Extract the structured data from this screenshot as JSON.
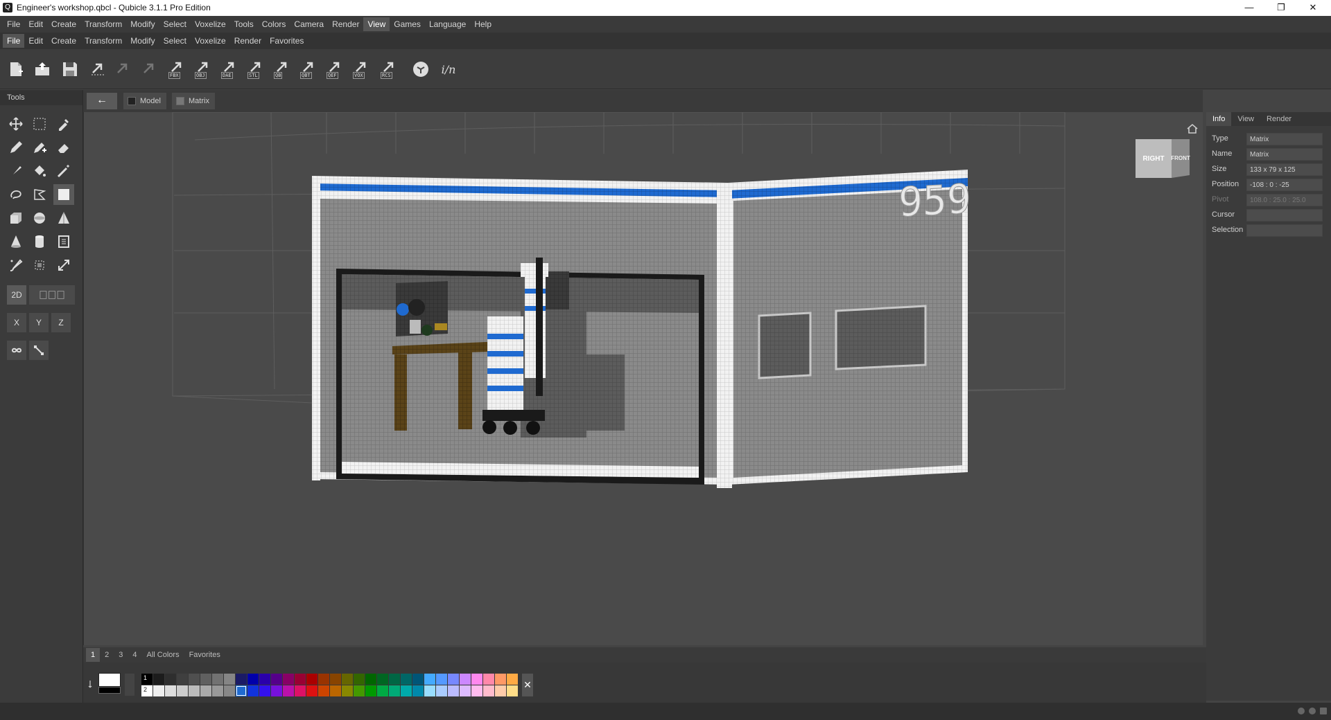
{
  "window": {
    "title": "Engineer's workshop.qbcl - Qubicle 3.1.1 Pro Edition",
    "minimize_glyph": "—",
    "restore_glyph": "❐",
    "close_glyph": "✕"
  },
  "menubar": [
    "File",
    "Edit",
    "Create",
    "Transform",
    "Modify",
    "Select",
    "Voxelize",
    "Tools",
    "Colors",
    "Camera",
    "Render",
    "View",
    "Games",
    "Language",
    "Help"
  ],
  "menubar_active": "View",
  "submenubar": [
    "File",
    "Edit",
    "Create",
    "Transform",
    "Modify",
    "Select",
    "Voxelize",
    "Render",
    "Favorites"
  ],
  "submenubar_active": "File",
  "toolbar": {
    "export_formats": [
      "FBX",
      "OBJ",
      "DAE",
      "STL",
      "QB",
      "QBT",
      "QEF",
      "VOX",
      "RCS"
    ],
    "extra_label": "i/n"
  },
  "tools_panel": {
    "title": "Tools",
    "mode_2d": "2D",
    "axes": [
      "X",
      "Y",
      "Z"
    ]
  },
  "view_header": {
    "back_glyph": "←",
    "crumbs": [
      "Model",
      "Matrix"
    ]
  },
  "nav_cube": {
    "right": "RIGHT",
    "front": "FRONT"
  },
  "scene": {
    "building_number": "959"
  },
  "right_panel": {
    "tabs": [
      "Info",
      "View",
      "Render"
    ],
    "active_tab": "Info",
    "properties": [
      {
        "label": "Type",
        "value": "Matrix",
        "dim": false
      },
      {
        "label": "Name",
        "value": "Matrix",
        "dim": false
      },
      {
        "label": "Size",
        "value": "133 x 79 x 125",
        "dim": false
      },
      {
        "label": "Position",
        "value": "-108 : 0 : -25",
        "dim": false
      },
      {
        "label": "Pivot",
        "value": "108.0 : 25.0 : 25.0",
        "dim": true
      },
      {
        "label": "Cursor",
        "value": "",
        "dim": false
      },
      {
        "label": "Selection",
        "value": "",
        "dim": false
      }
    ]
  },
  "palette": {
    "tabs": [
      "1",
      "2",
      "3",
      "4",
      "All Colors",
      "Favorites"
    ],
    "active_tab": "1",
    "primary_color": "#ffffff",
    "secondary_color": "#000000",
    "row_labels": [
      "1",
      "2"
    ],
    "close_glyph": "✕",
    "row1": [
      "#000000",
      "#1c1c1c",
      "#2e2e2e",
      "#3f3f3f",
      "#4f4f4f",
      "#606060",
      "#727272",
      "#858585",
      "#1a1a66",
      "#0000aa",
      "#2a00aa",
      "#55008a",
      "#880066",
      "#990033",
      "#aa0000",
      "#993300",
      "#884400",
      "#666600",
      "#336600",
      "#006600",
      "#006622",
      "#006644",
      "#006666",
      "#005577",
      "#44aaff",
      "#5599ff",
      "#7788ff",
      "#cc88ff",
      "#ff88ee",
      "#ff88aa",
      "#ff9966",
      "#ffaa44"
    ],
    "row2": [
      "#ffffff",
      "#eeeeee",
      "#dddddd",
      "#cccccc",
      "#bbbbbb",
      "#aaaaaa",
      "#999999",
      "#888888",
      "#1f6ad0",
      "#1133dd",
      "#3311ee",
      "#7711dd",
      "#bb11aa",
      "#dd1166",
      "#dd1111",
      "#cc4400",
      "#bb6600",
      "#888800",
      "#449900",
      "#009900",
      "#00aa44",
      "#00aa77",
      "#00aaaa",
      "#0088aa",
      "#99ddff",
      "#aaccff",
      "#bbbbff",
      "#ddbbff",
      "#ffbbee",
      "#ffbbcc",
      "#ffccaa",
      "#ffdd88"
    ],
    "row1_extra": [
      "#ffcc33",
      "#ddee33",
      "#aaee44",
      "#66ee66",
      "#44ee99",
      "#44eecc",
      "#33ddee"
    ],
    "row2_extra": [
      "#ffee99",
      "#eeff99",
      "#ccff99",
      "#aaffaa",
      "#99ffcc",
      "#99ffee",
      "#99ffff"
    ]
  },
  "colors": {
    "accent_blue": "#1f6ad0",
    "background": "#4a4a4a",
    "panel": "#3b3b3b"
  }
}
